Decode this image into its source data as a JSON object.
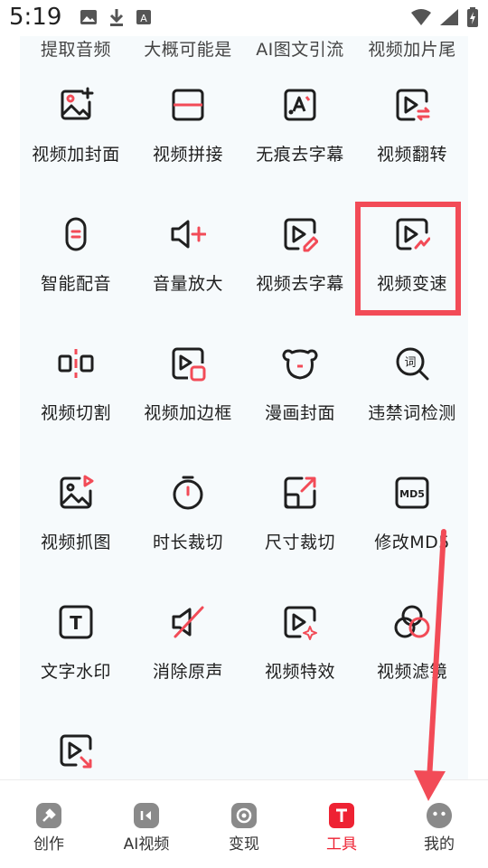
{
  "status_bar": {
    "time": "5:19"
  },
  "partial_row": [
    "提取音频",
    "大概可能是",
    "AI图文引流",
    "视频加片尾"
  ],
  "tools": [
    {
      "label": "视频加封面",
      "icon": "image-add-icon"
    },
    {
      "label": "视频拼接",
      "icon": "split-frame-icon"
    },
    {
      "label": "无痕去字幕",
      "icon": "text-erase-icon"
    },
    {
      "label": "视频翻转",
      "icon": "video-flip-icon"
    },
    {
      "label": "智能配音",
      "icon": "voice-icon"
    },
    {
      "label": "音量放大",
      "icon": "volume-up-icon"
    },
    {
      "label": "视频去字幕",
      "icon": "video-edit-icon"
    },
    {
      "label": "视频变速",
      "icon": "video-speed-icon"
    },
    {
      "label": "视频切割",
      "icon": "video-cut-icon"
    },
    {
      "label": "视频加边框",
      "icon": "video-border-icon"
    },
    {
      "label": "漫画封面",
      "icon": "bear-face-icon"
    },
    {
      "label": "违禁词检测",
      "icon": "word-search-icon"
    },
    {
      "label": "视频抓图",
      "icon": "video-capture-icon"
    },
    {
      "label": "时长裁切",
      "icon": "timer-icon"
    },
    {
      "label": "尺寸裁切",
      "icon": "resize-icon"
    },
    {
      "label": "修改MD5",
      "icon": "md5-icon"
    },
    {
      "label": "文字水印",
      "icon": "text-watermark-icon"
    },
    {
      "label": "消除原声",
      "icon": "mute-icon"
    },
    {
      "label": "视频特效",
      "icon": "video-sparkle-icon"
    },
    {
      "label": "视频滤镜",
      "icon": "filter-circles-icon"
    },
    {
      "label": "",
      "icon": "video-export-icon"
    }
  ],
  "md5_badge": "MD5",
  "word_badge": "词",
  "text_badge": "T",
  "bottom_nav": [
    {
      "label": "创作",
      "icon": "create-icon",
      "active": false
    },
    {
      "label": "AI视频",
      "icon": "ai-video-icon",
      "active": false
    },
    {
      "label": "变现",
      "icon": "monetize-icon",
      "active": false
    },
    {
      "label": "工具",
      "icon": "tools-icon",
      "active": true
    },
    {
      "label": "我的",
      "icon": "profile-icon",
      "active": false
    }
  ],
  "colors": {
    "accent": "#ee2233",
    "annotation": "#f24b57",
    "icon_stroke": "#1f1f1f",
    "icon_accent": "#f24b57"
  }
}
